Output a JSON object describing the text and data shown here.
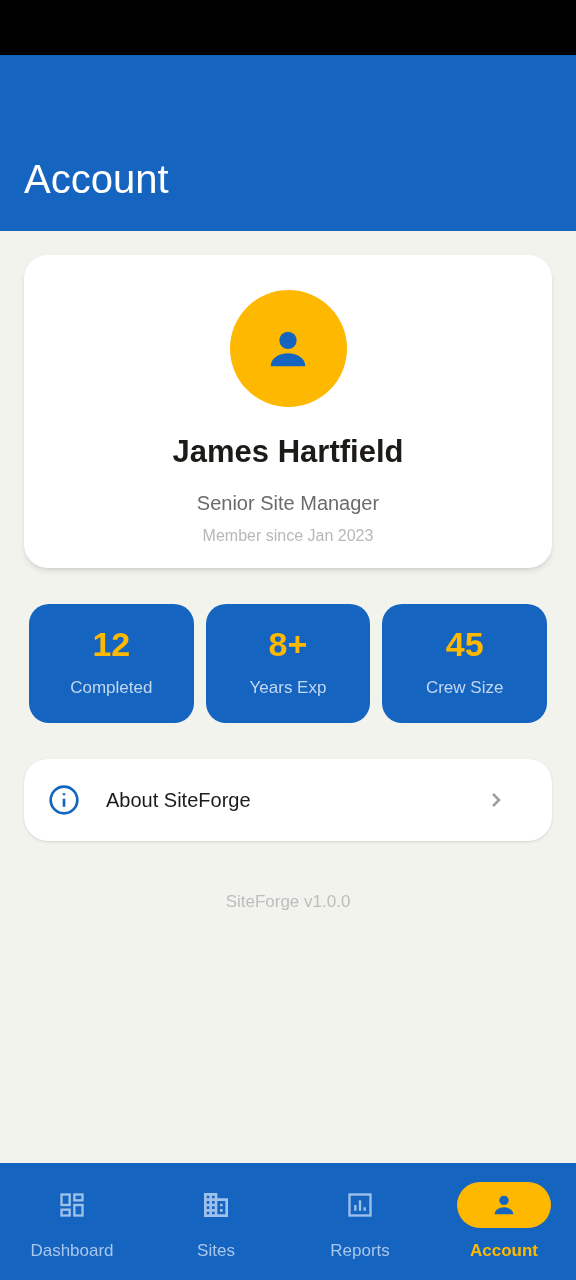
{
  "header": {
    "title": "Account"
  },
  "profile": {
    "name": "James Hartfield",
    "role": "Senior Site Manager",
    "member_since": "Member since Jan 2023"
  },
  "stats": [
    {
      "value": "12",
      "label": "Completed"
    },
    {
      "value": "8+",
      "label": "Years Exp"
    },
    {
      "value": "45",
      "label": "Crew Size"
    }
  ],
  "menu": [
    {
      "label": "About SiteForge"
    }
  ],
  "version": "SiteForge v1.0.0",
  "nav": [
    {
      "label": "Dashboard",
      "selected": false
    },
    {
      "label": "Sites",
      "selected": false
    },
    {
      "label": "Reports",
      "selected": false
    },
    {
      "label": "Account",
      "selected": true
    }
  ]
}
